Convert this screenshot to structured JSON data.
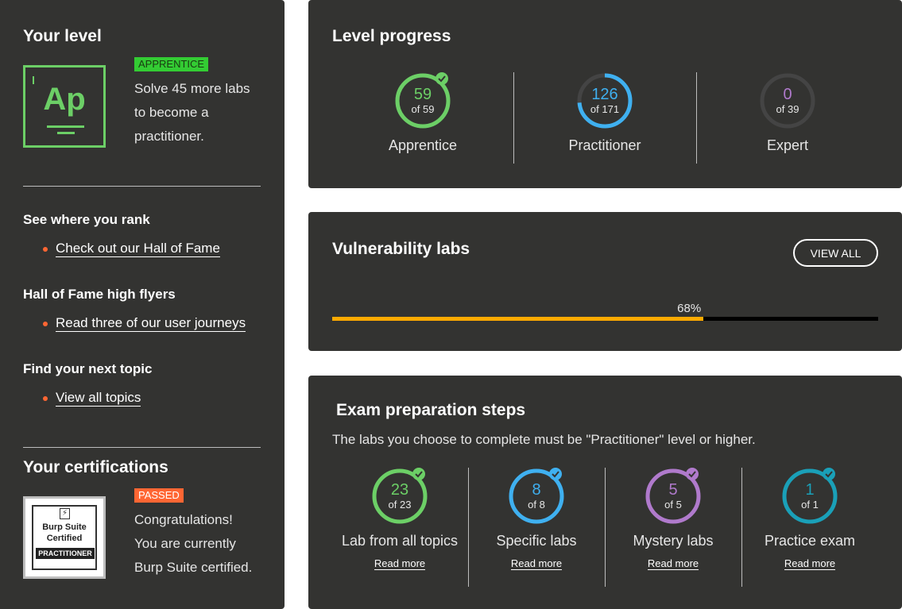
{
  "your_level": {
    "heading": "Your level",
    "badge": "APPRENTICE",
    "badge_color": "#33cc33",
    "icon_text": "Ap",
    "description_lines": [
      "Solve 45 more labs",
      "to become a",
      "practitioner."
    ]
  },
  "rank": {
    "heading": "See where you rank",
    "link": "Check out our Hall of Fame"
  },
  "high_flyers": {
    "heading": "Hall of Fame high flyers",
    "link": "Read three of our user journeys"
  },
  "next_topic": {
    "heading": "Find your next topic",
    "link": "View all topics"
  },
  "certifications": {
    "heading": "Your certifications",
    "badge": "PASSED",
    "badge_color": "#ff6633",
    "logo_lines": [
      "Burp Suite",
      "Certified",
      "PRACTITIONER"
    ],
    "description_lines": [
      "Congratulations!",
      "You are currently",
      "Burp Suite certified."
    ]
  },
  "level_progress": {
    "heading": "Level progress",
    "items": [
      {
        "value": "59",
        "total": "of 59",
        "label": "Apprentice",
        "fraction": 1.0,
        "color": "#6ccf66",
        "complete": true
      },
      {
        "value": "126",
        "total": "of 171",
        "label": "Practitioner",
        "fraction": 0.737,
        "color": "#3fb0f0",
        "complete": false
      },
      {
        "value": "0",
        "total": "of 39",
        "label": "Expert",
        "fraction": 0.0,
        "color": "#b07acc",
        "complete": false
      }
    ]
  },
  "vulnerability_labs": {
    "heading": "Vulnerability labs",
    "button": "VIEW ALL",
    "progress_label": "68%",
    "progress": 0.68,
    "bar_color": "#ffaa00"
  },
  "exam": {
    "heading": "Exam preparation steps",
    "subtitle": "The labs you choose to complete must be \"Practitioner\" level or higher.",
    "items": [
      {
        "value": "23",
        "total": "of 23",
        "label": "Lab from all topics",
        "link": "Read more",
        "fraction": 1.0,
        "color": "#6ccf66"
      },
      {
        "value": "8",
        "total": "of 8",
        "label": "Specific labs",
        "link": "Read more",
        "fraction": 1.0,
        "color": "#3fb0f0"
      },
      {
        "value": "5",
        "total": "of 5",
        "label": "Mystery labs",
        "link": "Read more",
        "fraction": 1.0,
        "color": "#b07acc"
      },
      {
        "value": "1",
        "total": "of 1",
        "label": "Practice exam",
        "link": "Read more",
        "fraction": 1.0,
        "color": "#1aa0b8"
      }
    ]
  }
}
